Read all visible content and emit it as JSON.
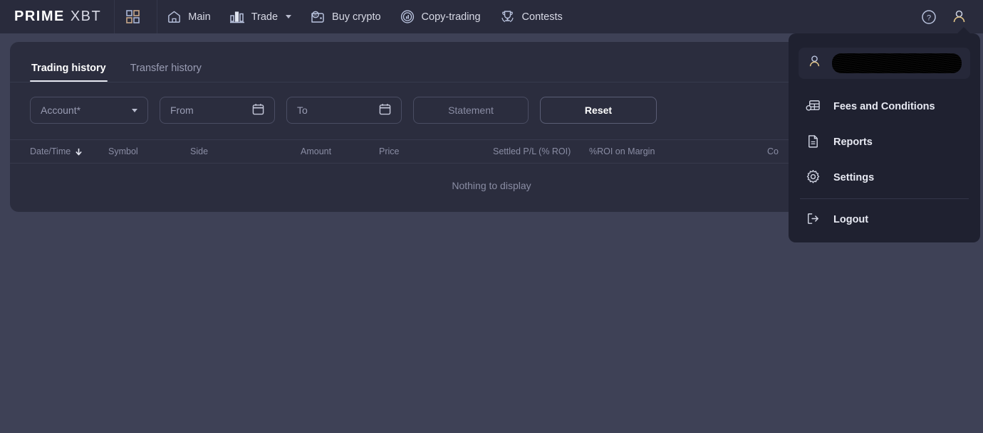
{
  "header": {
    "logo_primary": "PRIME",
    "logo_secondary": "XBT",
    "grid_icon": "grid-apps-icon",
    "nav": [
      {
        "label": "Main",
        "icon": "home-icon",
        "has_caret": false
      },
      {
        "label": "Trade",
        "icon": "bar-chart-icon",
        "has_caret": true
      },
      {
        "label": "Buy crypto",
        "icon": "wallet-coin-icon",
        "has_caret": false
      },
      {
        "label": "Copy-trading",
        "icon": "copy-trading-icon",
        "has_caret": false
      },
      {
        "label": "Contests",
        "icon": "trophy-icon",
        "has_caret": false
      }
    ],
    "help_icon": "question-circle-icon",
    "account_icon": "person-icon"
  },
  "card": {
    "tabs": [
      {
        "label": "Trading history",
        "active": true
      },
      {
        "label": "Transfer history",
        "active": false
      }
    ],
    "filters": {
      "account_label": "Account*",
      "from_placeholder": "From",
      "to_placeholder": "To",
      "from_value": "",
      "to_value": "",
      "statement_label": "Statement",
      "reset_label": "Reset",
      "calendar_icon": "calendar-icon",
      "dropdown_icon": "chevron-down-icon"
    },
    "table": {
      "columns": [
        {
          "label": "Date/Time",
          "sorted": true,
          "sort_dir": "desc"
        },
        {
          "label": "Symbol",
          "sorted": false
        },
        {
          "label": "Side",
          "sorted": false
        },
        {
          "label": "Amount",
          "sorted": false
        },
        {
          "label": "Price",
          "sorted": false
        },
        {
          "label": "Settled P/L (% ROI)",
          "sorted": false
        },
        {
          "label": "%ROI on Margin",
          "sorted": false
        },
        {
          "label": "Co",
          "sorted": false
        }
      ],
      "empty_message": "Nothing to display"
    }
  },
  "user_menu": {
    "username": "",
    "username_redacted": true,
    "user_icon": "person-icon",
    "items": [
      {
        "label": "Fees and Conditions",
        "icon": "fees-table-icon"
      },
      {
        "label": "Reports",
        "icon": "document-icon"
      },
      {
        "label": "Settings",
        "icon": "gear-icon"
      },
      {
        "label": "Logout",
        "icon": "logout-icon"
      }
    ]
  },
  "colors": {
    "header_bg": "#292b3c",
    "page_bg": "#3e4156",
    "card_bg": "#2b2d3e",
    "dropdown_bg": "#1f2130",
    "text_primary": "#ffffff",
    "text_muted": "#8a8da4",
    "border": "#4a4d63"
  }
}
